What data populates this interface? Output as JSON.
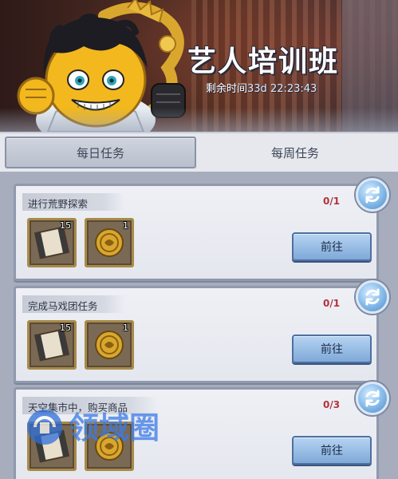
{
  "banner": {
    "title": "艺人培训班",
    "timer_label": "剩余时间",
    "timer_value": "33d 22:23:43"
  },
  "tabs": [
    {
      "label": "每日任务",
      "active": true
    },
    {
      "label": "每周任务",
      "active": false
    }
  ],
  "tasks": [
    {
      "title": "进行荒野探索",
      "progress": "0/1",
      "rewards": [
        {
          "icon": "film-reel-icon",
          "count": "15"
        },
        {
          "icon": "gold-coin-icon",
          "count": "1"
        }
      ],
      "button_label": "前往"
    },
    {
      "title": "完成马戏团任务",
      "progress": "0/1",
      "rewards": [
        {
          "icon": "film-reel-icon",
          "count": "15"
        },
        {
          "icon": "gold-coin-icon",
          "count": "1"
        }
      ],
      "button_label": "前往"
    },
    {
      "title": "天空集市中，购买商品",
      "progress": "0/3",
      "rewards": [
        {
          "icon": "film-reel-icon",
          "count": ""
        },
        {
          "icon": "gold-coin-icon",
          "count": ""
        }
      ],
      "button_label": "前往"
    }
  ],
  "watermark": "领域圈",
  "colors": {
    "progress": "#b2323a",
    "button": "#8fb5e0",
    "card": "#e8eaf0"
  }
}
